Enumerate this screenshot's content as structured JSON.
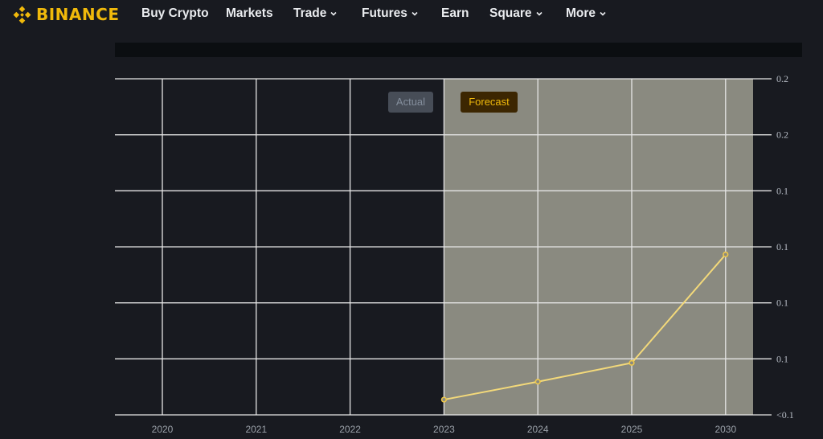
{
  "nav": {
    "brand": "BINANCE",
    "items": [
      {
        "label": "Buy Crypto",
        "has_dropdown": false
      },
      {
        "label": "Markets",
        "has_dropdown": false
      },
      {
        "label": "Trade",
        "has_dropdown": true
      },
      {
        "label": "Futures",
        "has_dropdown": true
      },
      {
        "label": "Earn",
        "has_dropdown": false
      },
      {
        "label": "Square",
        "has_dropdown": true
      },
      {
        "label": "More",
        "has_dropdown": true
      }
    ]
  },
  "colors": {
    "brand": "#f0b90b",
    "background": "#181a20",
    "forecast_region": "#8a8a80",
    "line": "#f3d97a",
    "grid": "#e6e6e6"
  },
  "chart_data": {
    "type": "line",
    "title": "",
    "xlabel": "",
    "ylabel": "",
    "categories": [
      "2020",
      "2021",
      "2022",
      "2023",
      "2024",
      "2025",
      "2030"
    ],
    "legend": [
      {
        "label": "Actual",
        "active": false
      },
      {
        "label": "Forecast",
        "active": true
      }
    ],
    "legend_placement": "top-center",
    "forecast_start": "2023",
    "y_ticks": [
      "<0.1",
      "0.1",
      "0.1",
      "0.1",
      "0.1",
      "0.2",
      "0.2"
    ],
    "ylim": [
      0.05,
      0.2
    ],
    "grid": true,
    "series": [
      {
        "name": "Forecast",
        "x": [
          "2023",
          "2024",
          "2025",
          "2030"
        ],
        "values": [
          0.0568,
          0.0648,
          0.0732,
          0.1216
        ]
      }
    ]
  }
}
